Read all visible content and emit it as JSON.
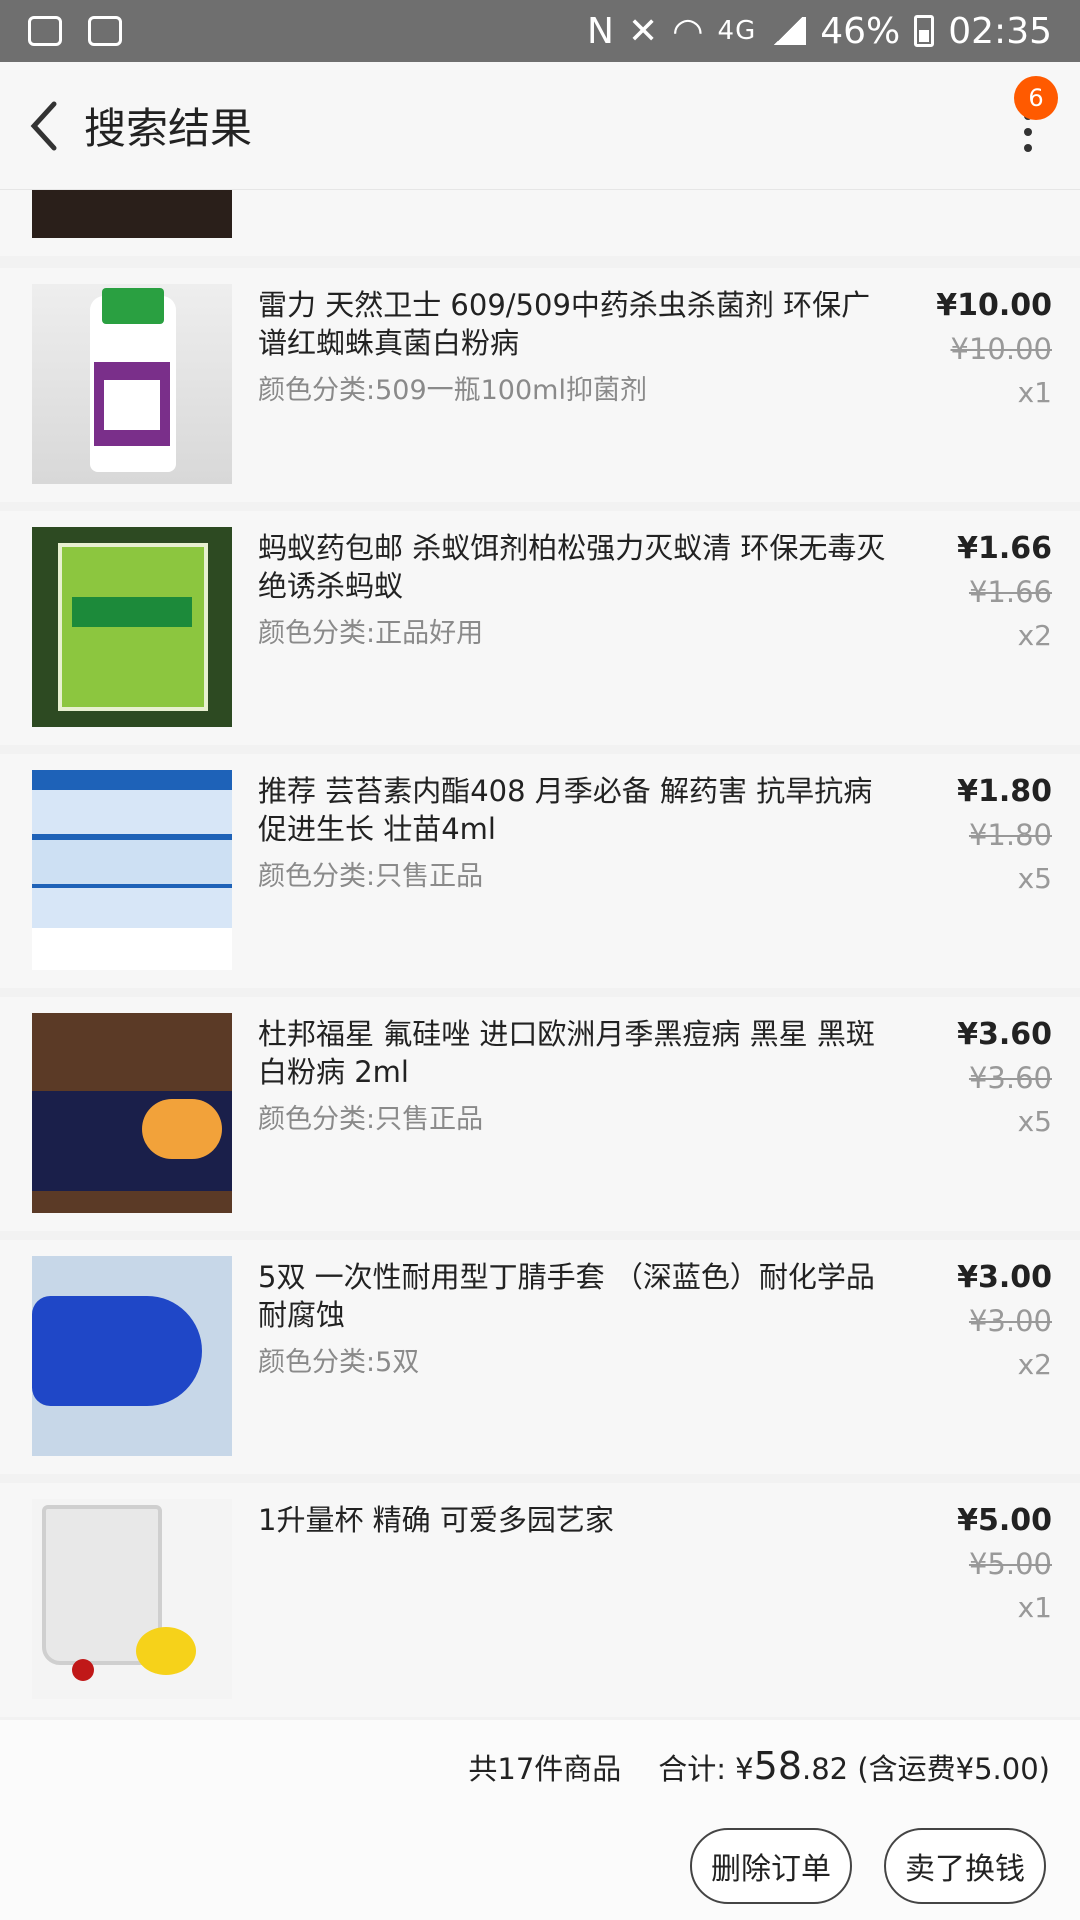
{
  "status_bar": {
    "network": "4G",
    "battery": "46%",
    "time": "02:35"
  },
  "header": {
    "title": "搜索结果",
    "badge_count": "6"
  },
  "items": [
    {
      "name": "雷力 天然卫士 609/509中药杀虫杀菌剂 环保广谱红蜘蛛真菌白粉病",
      "spec": "颜色分类:509一瓶100ml抑菌剂",
      "price": "¥10.00",
      "orig_price": "¥10.00",
      "qty": "x1"
    },
    {
      "name": "蚂蚁药包邮  杀蚁饵剂柏松强力灭蚁清 环保无毒灭绝诱杀蚂蚁",
      "spec": "颜色分类:正品好用",
      "price": "¥1.66",
      "orig_price": "¥1.66",
      "qty": "x2"
    },
    {
      "name": "推荐 芸苔素内酯408 月季必备 解药害 抗旱抗病促进生长 壮苗4ml",
      "spec": "颜色分类:只售正品",
      "price": "¥1.80",
      "orig_price": "¥1.80",
      "qty": "x5"
    },
    {
      "name": "杜邦福星 氟硅唑 进口欧洲月季黑痘病 黑星 黑斑白粉病 2ml",
      "spec": "颜色分类:只售正品",
      "price": "¥3.60",
      "orig_price": "¥3.60",
      "qty": "x5"
    },
    {
      "name": "5双 一次性耐用型丁腈手套 （深蓝色）耐化学品耐腐蚀",
      "spec": "颜色分类:5双",
      "price": "¥3.00",
      "orig_price": "¥3.00",
      "qty": "x2"
    },
    {
      "name": "1升量杯  精确  可爱多园艺家",
      "spec": "",
      "price": "¥5.00",
      "orig_price": "¥5.00",
      "qty": "x1"
    }
  ],
  "summary": {
    "count_text": "共17件商品",
    "total_label": "合计: ¥",
    "total_int": "58",
    "total_dec": ".82",
    "shipping": "(含运费¥5.00)"
  },
  "actions": {
    "delete_label": "删除订单",
    "sell_label": "卖了换钱"
  },
  "colors": {
    "badge": "#ff5a00",
    "statusbar": "#6f6f6f"
  }
}
